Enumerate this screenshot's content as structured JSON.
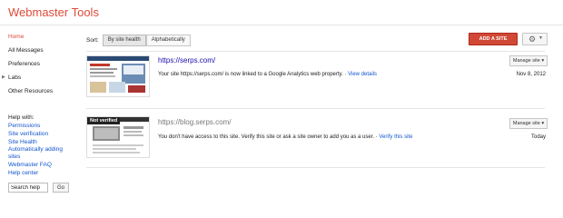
{
  "app": {
    "title": "Webmaster Tools"
  },
  "sidebar": {
    "items": [
      {
        "label": "Home",
        "active": true
      },
      {
        "label": "All Messages"
      },
      {
        "label": "Preferences"
      },
      {
        "label": "Labs",
        "expandable": true
      },
      {
        "label": "Other Resources"
      }
    ]
  },
  "help": {
    "title": "Help with:",
    "links": [
      "Permissions",
      "Site verification",
      "Site Health",
      "Automatically adding sites",
      "Webmaster FAQ",
      "Help center"
    ],
    "search_placeholder": "Search help",
    "go_label": "Go"
  },
  "toolbar": {
    "sort_label": "Sort:",
    "sort_options": [
      "By site health",
      "Alphabetically"
    ],
    "add_site_label": "ADD A SITE"
  },
  "sites": [
    {
      "url": "https://serps.com/",
      "verified": true,
      "manage_label": "Manage site",
      "message": "Your site https://serps.com/ is now linked to a Google Analytics web property. · ",
      "link_text": "View details",
      "date": "Nov 8, 2012",
      "url_color": "#1a0dab"
    },
    {
      "url": "https://blog.serps.com/",
      "verified": false,
      "badge": "Not verified",
      "manage_label": "Manage site",
      "message": "You don't have access to this site. Verify this site or ask a site owner to add you as a user. · ",
      "link_text": "Verify this site",
      "date": "Today",
      "url_color": "#777777"
    }
  ],
  "colors": {
    "brand": "#dd4b39",
    "add_button": "#d14836",
    "link": "#1155cc"
  }
}
